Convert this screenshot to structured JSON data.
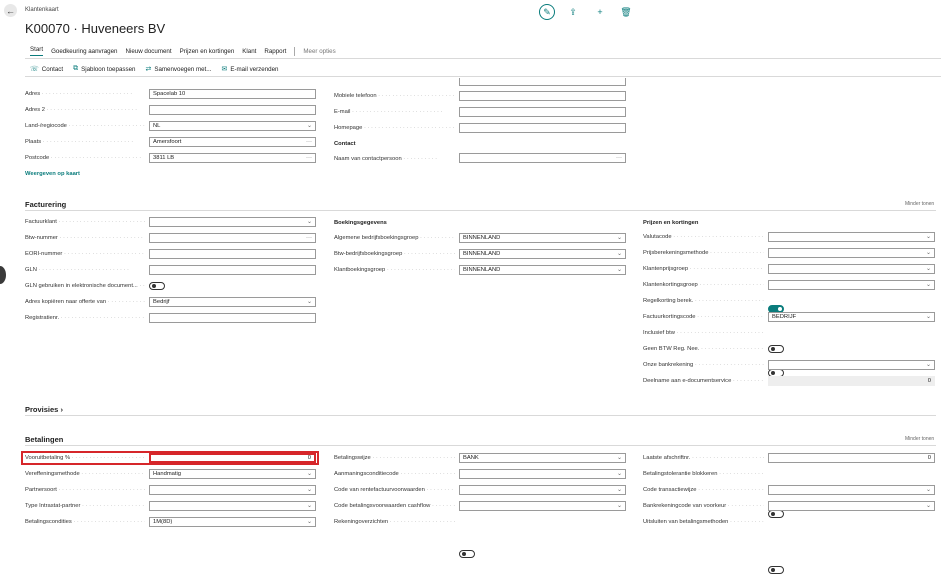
{
  "header": {
    "breadcrumb": "Klantenkaart",
    "title": "K00070 · Huveneers BV",
    "menu": [
      "Start",
      "Goedkeuring aanvragen",
      "Nieuw document",
      "Prijzen en kortingen",
      "Klant",
      "Rapport"
    ],
    "more": "Meer opties",
    "actions": [
      "Contact",
      "Sjabloon toepassen",
      "Samenvoegen met...",
      "E-mail verzenden"
    ]
  },
  "address": {
    "left": [
      {
        "label": "Adres",
        "value": "Spacelab 10",
        "type": "text"
      },
      {
        "label": "Adres 2",
        "value": "",
        "type": "text"
      },
      {
        "label": "Land-/regiocode",
        "value": "NL",
        "type": "select"
      },
      {
        "label": "Plaats",
        "value": "Amersfoort",
        "type": "lookup"
      },
      {
        "label": "Postcode",
        "value": "3811 LB",
        "type": "lookup"
      }
    ],
    "right": [
      {
        "label": "Mobiele telefoon",
        "value": ""
      },
      {
        "label": "E-mail",
        "value": ""
      },
      {
        "label": "Homepage",
        "value": ""
      }
    ],
    "contact_heading": "Contact",
    "contact_name_label": "Naam van contactpersoon",
    "map_link": "Weergeven op kaart"
  },
  "facturering": {
    "title": "Facturering",
    "toggle_text": "Minder tonen",
    "col1": [
      {
        "label": "Factuurklant",
        "value": "",
        "type": "select"
      },
      {
        "label": "Btw-nummer",
        "value": "",
        "type": "lookup"
      },
      {
        "label": "EORI-nummer",
        "value": "",
        "type": "text"
      },
      {
        "label": "GLN",
        "value": "",
        "type": "text"
      },
      {
        "label": "GLN gebruiken in elektronische document...",
        "type": "toggle",
        "on": false
      },
      {
        "label": "Adres kopiëren naar offerte van",
        "value": "Bedrijf",
        "type": "select"
      },
      {
        "label": "Registratienr.",
        "value": "",
        "type": "text"
      }
    ],
    "col2_heading": "Boekingsgegevens",
    "col2": [
      {
        "label": "Algemene bedrijfsboekingsgroep",
        "value": "BINNENLAND"
      },
      {
        "label": "Btw-bedrijfsboekingsgroep",
        "value": "BINNENLAND"
      },
      {
        "label": "Klantboekingsgroep",
        "value": "BINNENLAND"
      }
    ],
    "col3_heading": "Prijzen en kortingen",
    "col3": [
      {
        "label": "Valutacode",
        "value": "",
        "type": "select"
      },
      {
        "label": "Prijsberekeningsmethode",
        "value": "",
        "type": "select"
      },
      {
        "label": "Klantenprijsgroep",
        "value": "",
        "type": "select"
      },
      {
        "label": "Klantenkortingsgroep",
        "value": "",
        "type": "select"
      },
      {
        "label": "Regelkorting berek.",
        "type": "toggle",
        "on": true
      },
      {
        "label": "Factuurkortingscode",
        "value": "BEDRIJF",
        "type": "select"
      },
      {
        "label": "Inclusief btw",
        "type": "toggle",
        "on": false
      },
      {
        "label": "Geen BTW Reg. Nee.",
        "type": "toggle",
        "on": false
      },
      {
        "label": "Onze bankrekening",
        "value": "",
        "type": "select"
      },
      {
        "label": "Deelname aan e-documentservice",
        "value": "0",
        "type": "readonly"
      }
    ]
  },
  "provisies": {
    "title": "Provisies"
  },
  "betalingen": {
    "title": "Betalingen",
    "toggle_text": "Minder tonen",
    "col1": [
      {
        "label": "Vooruitbetaling %",
        "value": "0",
        "type": "number"
      },
      {
        "label": "Vereffeningsmethode",
        "value": "Handmatig",
        "type": "select"
      },
      {
        "label": "Partnersoort",
        "value": "",
        "type": "select"
      },
      {
        "label": "Type Intrastat-partner",
        "value": "",
        "type": "select"
      },
      {
        "label": "Betalingscondities",
        "value": "1M(8D)",
        "type": "select"
      }
    ],
    "col2": [
      {
        "label": "Betalingswijze",
        "value": "BANK",
        "type": "select"
      },
      {
        "label": "Aanmaningsconditiecode",
        "value": "",
        "type": "select"
      },
      {
        "label": "Code van rentefactuurvoorwaarden",
        "value": "",
        "type": "select"
      },
      {
        "label": "Code betalingsvoorwaarden cashflow",
        "value": "",
        "type": "select"
      },
      {
        "label": "Rekeningoverzichten",
        "type": "toggle",
        "on": false
      }
    ],
    "col3": [
      {
        "label": "Laatste afschriftnr.",
        "value": "0",
        "type": "number"
      },
      {
        "label": "Betalingstolerantie blokkeren",
        "type": "toggle",
        "on": false
      },
      {
        "label": "Code transactiewijze",
        "value": "",
        "type": "select"
      },
      {
        "label": "Bankrekeningcode van voorkeur",
        "value": "",
        "type": "select"
      },
      {
        "label": "Uitsluiten van betalingsmethoden",
        "type": "toggle",
        "on": false
      }
    ]
  }
}
